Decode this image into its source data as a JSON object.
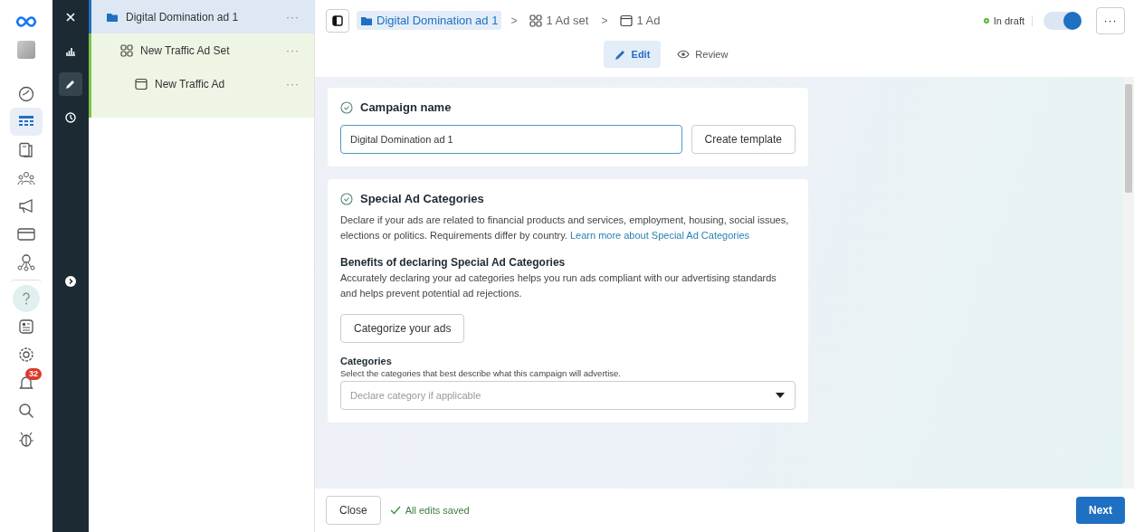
{
  "nav_rail": {
    "items": [
      {
        "kind": "logo",
        "selected": false
      },
      {
        "kind": "account",
        "selected": false
      },
      {
        "kind": "gauge",
        "selected": false
      },
      {
        "kind": "table",
        "selected": true
      },
      {
        "kind": "pages",
        "selected": false
      },
      {
        "kind": "people",
        "selected": false
      },
      {
        "kind": "megaphone",
        "selected": false
      },
      {
        "kind": "card",
        "selected": false
      },
      {
        "kind": "network",
        "selected": false
      },
      {
        "kind": "help",
        "selected": false
      },
      {
        "kind": "news",
        "selected": false
      },
      {
        "kind": "settings",
        "selected": false
      },
      {
        "kind": "bell",
        "selected": false,
        "badge": "32"
      },
      {
        "kind": "search",
        "selected": false
      },
      {
        "kind": "bug",
        "selected": false
      }
    ]
  },
  "tool_column": {
    "items": [
      {
        "kind": "close",
        "selected": false
      },
      {
        "kind": "chart",
        "selected": false
      },
      {
        "kind": "edit",
        "selected": true
      },
      {
        "kind": "history",
        "selected": false
      }
    ]
  },
  "tree": {
    "items": [
      {
        "kind": "campaign",
        "label": "Digital Domination ad 1",
        "menu": "···",
        "selected": true,
        "children": [
          {
            "kind": "adset",
            "label": "New Traffic Ad Set",
            "menu": "···",
            "selected": false,
            "children": [
              {
                "kind": "ad",
                "label": "New Traffic Ad",
                "menu": "···",
                "selected": false
              }
            ]
          }
        ]
      }
    ]
  },
  "header": {
    "breadcrumbs": [
      {
        "kind": "campaign",
        "label": "Digital Domination ad 1",
        "selected": true
      },
      {
        "kind": "adset",
        "label": "1 Ad set",
        "selected": false
      },
      {
        "kind": "ad",
        "label": "1 Ad",
        "selected": false
      }
    ],
    "separator": ">",
    "mode_tabs": [
      {
        "kind": "edit",
        "label": "Edit",
        "selected": true
      },
      {
        "kind": "review",
        "label": "Review",
        "selected": false
      }
    ],
    "status": {
      "label": "In draft",
      "color": "#5bb534"
    },
    "toggle": {
      "on": true
    },
    "more": "···"
  },
  "campaign_card": {
    "title": "Campaign name",
    "value": "Digital Domination ad 1",
    "button": "Create template"
  },
  "special_card": {
    "title": "Special Ad Categories",
    "description": "Declare if your ads are related to financial products and services, employment, housing, social issues, elections or politics. Requirements differ by country.",
    "link": "Learn more about Special Ad Categories",
    "benefits_title": "Benefits of declaring Special Ad Categories",
    "benefits_text": "Accurately declaring your ad categories helps you run ads compliant with our advertising standards and helps prevent potential ad rejections.",
    "button": "Categorize your ads",
    "categories_label": "Categories",
    "categories_hint": "Select the categories that best describe what this campaign will advertise.",
    "categories_placeholder": "Declare category if applicable"
  },
  "footer": {
    "close": "Close",
    "saved": "All edits saved",
    "next": "Next"
  }
}
